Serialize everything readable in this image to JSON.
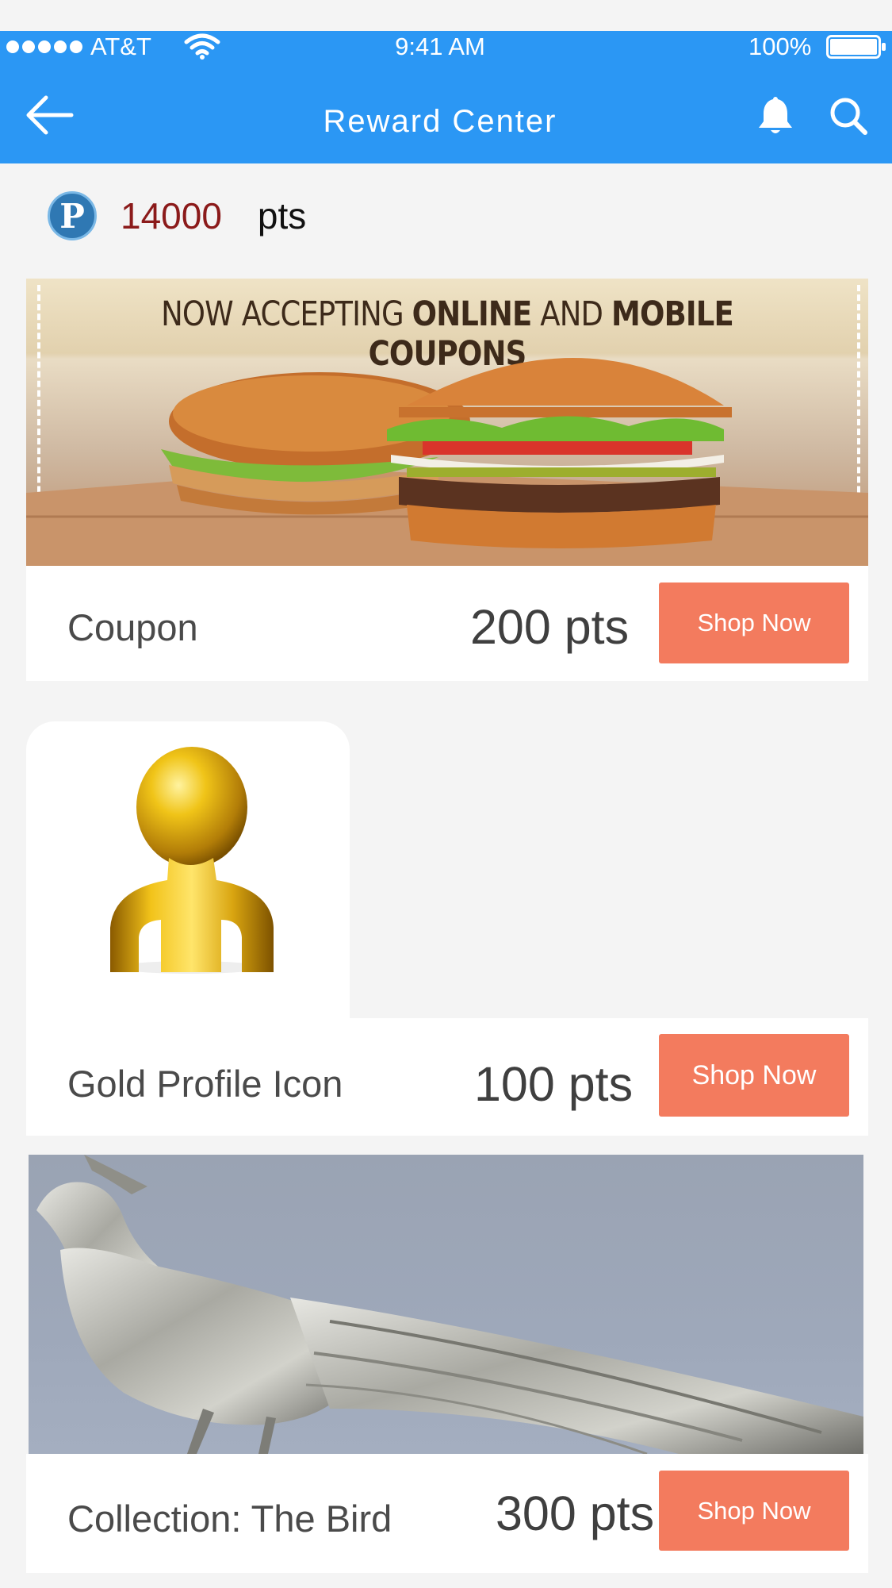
{
  "status_bar": {
    "carrier": "AT&T",
    "time": "9:41 AM",
    "battery": "100%"
  },
  "nav": {
    "title": "Reward Center",
    "back_icon": "arrow-left-icon",
    "bell_icon": "bell-icon",
    "search_icon": "search-icon"
  },
  "points": {
    "logo_letter": "P",
    "value": "14000",
    "unit": "pts"
  },
  "coupon_banner": {
    "headline_part1": "NOW ACCEPTING ",
    "headline_bold1": "ONLINE",
    "headline_part2": " AND ",
    "headline_bold2": "MOBILE COUPONS"
  },
  "rewards": [
    {
      "name": "Coupon",
      "price": "200 pts",
      "button": "Shop Now"
    },
    {
      "name": "Gold Profile Icon",
      "price": "100 pts",
      "button": "Shop Now"
    },
    {
      "name": "Collection: The Bird",
      "price": "300 pts",
      "button": "Shop Now"
    }
  ],
  "colors": {
    "accent_blue": "#2b97f4",
    "button_orange": "#f37b5e",
    "points_red": "#8b1a1a"
  }
}
